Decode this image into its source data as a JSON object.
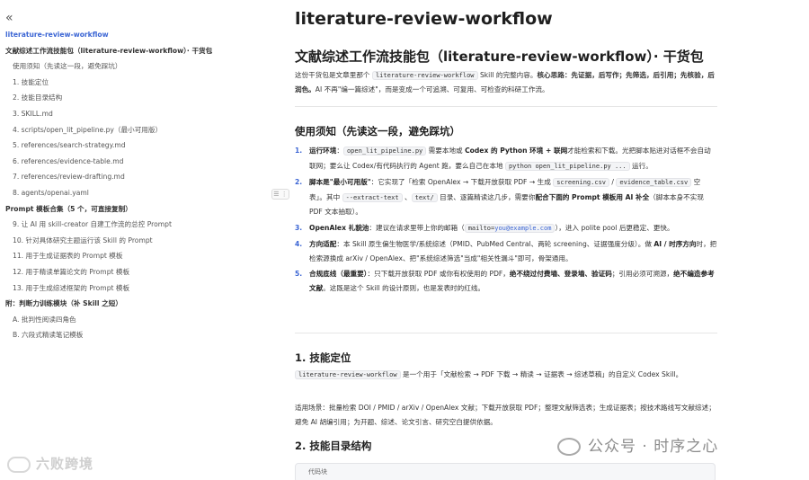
{
  "sidebar": {
    "collapse_icon": "«",
    "toc": [
      {
        "label": "literature-review-workflow",
        "level": 0,
        "active": true
      },
      {
        "label": "文献综述工作流技能包（literature-review-workflow）· 干货包",
        "level": 0
      },
      {
        "label": "使用须知（先读这一段，避免踩坑）",
        "level": 1
      },
      {
        "label": "1. 技能定位",
        "level": 1
      },
      {
        "label": "2. 技能目录结构",
        "level": 1
      },
      {
        "label": "3. SKILL.md",
        "level": 1
      },
      {
        "label": "4. scripts/open_lit_pipeline.py（最小可用版）",
        "level": 1
      },
      {
        "label": "5. references/search-strategy.md",
        "level": 1
      },
      {
        "label": "6. references/evidence-table.md",
        "level": 1
      },
      {
        "label": "7. references/review-drafting.md",
        "level": 1
      },
      {
        "label": "8. agents/openai.yaml",
        "level": 1
      },
      {
        "label": "Prompt 模板合集（5 个，可直接复制）",
        "level": 0
      },
      {
        "label": "9. 让 AI 用 skill-creator 自建工作流的总控 Prompt",
        "level": 1
      },
      {
        "label": "10. 针对具体研究主题运行该 Skill 的 Prompt",
        "level": 1
      },
      {
        "label": "11. 用于生成证据表的 Prompt 模板",
        "level": 1
      },
      {
        "label": "12. 用于精读单篇论文的 Prompt 模板",
        "level": 1
      },
      {
        "label": "13. 用于生成综述框架的 Prompt 模板",
        "level": 1
      },
      {
        "label": "附：判断力训练模块（补 Skill 之短）",
        "level": 0
      },
      {
        "label": "A. 批判性阅读四角色",
        "level": 1
      },
      {
        "label": "B. 六段式精读笔记模板",
        "level": 1
      }
    ],
    "watermark": "六败跨境"
  },
  "main": {
    "page_title": "literature-review-workflow",
    "h1": "文献综述工作流技能包（literature-review-workflow）· 干货包",
    "intro": {
      "t1": "这份干货包是文章里那个 ",
      "code1": "literature-review-workflow",
      "t2": " Skill 的完整内容。",
      "b1": "核心思路：先证据，后写作；先筛选，后引用；先核验，后润色。",
      "t3": "AI 不再\"编一篇综述\"，而是变成一个可追溯、可复用、可检查的科研工作流。"
    },
    "notice_title": "使用须知（先读这一段，避免踩坑）",
    "notice_items": [
      {
        "num": "1.",
        "html": "<b>运行环境</b>：<span class=\"code\">open_lit_pipeline.py</span> 需要本地或 <b>Codex 的 Python 环境 + 联网</b>才能检索和下载。光把脚本贴进对话框不会自动联网；要么让 Codex/有代码执行的 Agent 跑，要么自己在本地 <span class=\"code\">python open_lit_pipeline.py ...</span> 运行。"
      },
      {
        "num": "2.",
        "html": "<b>脚本是\"最小可用版\"</b>：它实现了「检索 OpenAlex → 下载开放获取 PDF → 生成 <span class=\"code\">screening.csv</span> / <span class=\"code\">evidence_table.csv</span> 空表」。其中 <span class=\"code\">--extract-text</span> 、<span class=\"code\">text/</span> 目录、逐篇精读这几步，需要你<b>配合下面的 Prompt 模板用 AI 补全</b>（脚本本身不实现 PDF 文本抽取）。"
      },
      {
        "num": "3.",
        "html": "<b>OpenAlex 礼貌池</b>：建议在请求里带上你的邮箱（<span class=\"code\">mailto=<span class=\"link\">you@example.com</span></span>），进入 polite pool 后更稳定、更快。"
      },
      {
        "num": "4.",
        "html": "<b>方向适配</b>：本 Skill 原生偏生物医学/系统综述（PMID、PubMed Central、两轮 screening、证据强度分级）。做 <b>AI / 时序方向</b>时，把检索源换成 arXiv / OpenAlex、把\"系统综述筛选\"当成\"相关性漏斗\"即可，骨架通用。"
      },
      {
        "num": "5.",
        "html": "<b>合规底线（最重要）</b>：只下载开放获取 PDF 或你有权使用的 PDF，<b>绝不绕过付费墙、登录墙、验证码</b>；引用必须可溯源，<b>绝不编造参考文献</b>。这既是这个 Skill 的设计原则，也是发表时的红线。"
      }
    ],
    "sec1_title": "1. 技能定位",
    "sec1": {
      "code": "literature-review-workflow",
      "t1": " 是一个用于「文献检索 → PDF 下载 → 精读 → 证据表 → 综述草稿」的自定义 Codex Skill。",
      "t2": "适用场景：批量检索 DOI / PMID / arXiv / OpenAlex 文献；下载开放获取 PDF；整理文献筛选表；生成证据表；按技术路线写文献综述；避免 AI 胡编引用；为开题、综述、论文引言、研究空白提供依据。"
    },
    "sec2_title": "2. 技能目录结构",
    "codeblock_label": "代码块"
  },
  "watermark_right": "公众号 · 时序之心"
}
